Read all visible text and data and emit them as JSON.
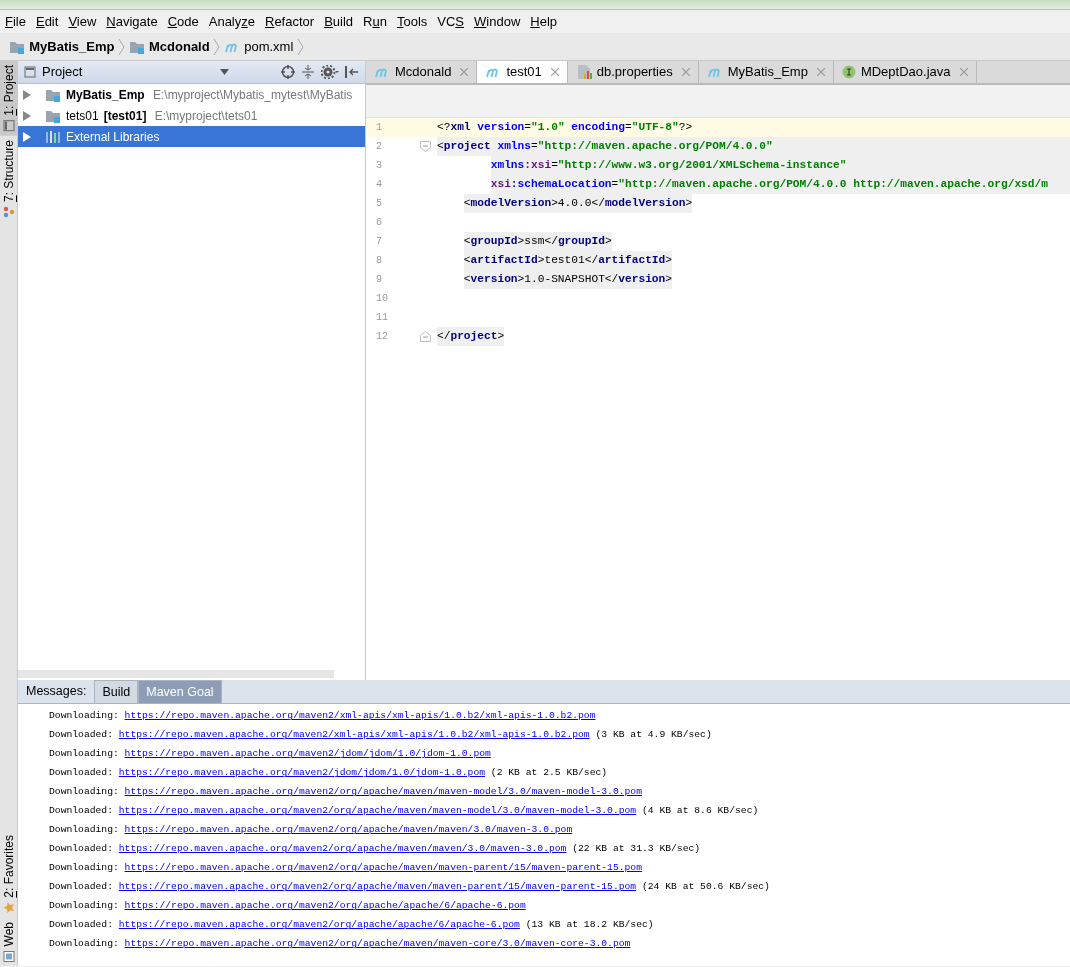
{
  "menu": [
    {
      "key": "F",
      "post": "ile"
    },
    {
      "key": "E",
      "post": "dit"
    },
    {
      "key": "V",
      "post": "iew"
    },
    {
      "key": "N",
      "post": "avigate"
    },
    {
      "key": "C",
      "post": "ode"
    },
    {
      "pre": "Analy",
      "key": "z",
      "post": "e"
    },
    {
      "key": "R",
      "post": "efactor"
    },
    {
      "key": "B",
      "post": "uild"
    },
    {
      "pre": "R",
      "key": "u",
      "post": "n"
    },
    {
      "key": "T",
      "post": "ools"
    },
    {
      "pre": "VC",
      "key": "S"
    },
    {
      "key": "W",
      "post": "indow"
    },
    {
      "key": "H",
      "post": "elp"
    }
  ],
  "breadcrumb": [
    {
      "label": "MyBatis_Emp",
      "kind": "module"
    },
    {
      "label": "Mcdonald",
      "kind": "module"
    },
    {
      "label": "pom.xml",
      "kind": "maven"
    }
  ],
  "side_tabs_top": [
    {
      "key": "1",
      "post": ": Project",
      "selected": true,
      "kind": "project"
    },
    {
      "key": "7",
      "post": ": Structure",
      "selected": false,
      "kind": "structure"
    }
  ],
  "side_tabs_bottom": [
    {
      "key": "2",
      "post": ": Favorites",
      "selected": false,
      "kind": "favorites"
    },
    {
      "post": "Web",
      "selected": false,
      "kind": "web"
    }
  ],
  "project_panel": {
    "title": "Project",
    "items": [
      {
        "name": "MyBatis_Emp",
        "bold": true,
        "path": "E:\\myproject\\Mybatis_mytest\\MyBatis",
        "kind": "module",
        "selected": false,
        "expanded": false
      },
      {
        "name": "tets01",
        "bold": false,
        "module": "[test01]",
        "path": "E:\\myproject\\tets01",
        "kind": "module",
        "selected": false,
        "expanded": false
      },
      {
        "name": "External Libraries",
        "bold": false,
        "kind": "library",
        "selected": true,
        "expanded": false
      }
    ]
  },
  "editor_tabs": [
    {
      "label": "Mcdonald",
      "kind": "maven",
      "selected": false
    },
    {
      "label": "test01",
      "kind": "maven",
      "selected": true
    },
    {
      "label": "db.properties",
      "kind": "properties",
      "selected": false
    },
    {
      "label": "MyBatis_Emp",
      "kind": "maven",
      "selected": false
    },
    {
      "label": "MDeptDao.java",
      "kind": "interface",
      "selected": false
    }
  ],
  "code": [
    {
      "no": "1",
      "kind": "declaration",
      "current": true,
      "matched": false,
      "shaded": false,
      "tokens": [
        {
          "kind": "punct",
          "text": "<?"
        },
        {
          "kind": "tag",
          "text": "xml"
        },
        {
          "kind": "attr",
          "text": " version"
        },
        {
          "kind": "punct",
          "text": "="
        },
        {
          "kind": "value",
          "text": "\"1.0\""
        },
        {
          "kind": "attr",
          "text": " encoding"
        },
        {
          "kind": "punct",
          "text": "="
        },
        {
          "kind": "value",
          "text": "\"UTF-8\""
        },
        {
          "kind": "punct",
          "text": "?>"
        }
      ]
    },
    {
      "no": "2",
      "kind": "open",
      "current": false,
      "matched": true,
      "shaded": false,
      "tokens": [
        {
          "kind": "punct",
          "text": "<"
        },
        {
          "kind": "tag",
          "text": "project"
        },
        {
          "kind": "attr",
          "text": " xmlns"
        },
        {
          "kind": "punct",
          "text": "="
        },
        {
          "kind": "value",
          "text": "\"http://maven.apache.org/POM/4.0.0\""
        }
      ]
    },
    {
      "no": "3",
      "kind": "continuation",
      "current": false,
      "matched": true,
      "shaded": false,
      "tokens": [
        {
          "kind": "attr",
          "text": "xmlns"
        },
        {
          "kind": "ns",
          "text": ":xsi"
        },
        {
          "kind": "punct",
          "text": "="
        },
        {
          "kind": "value",
          "text": "\"http://www.w3.org/2001/XMLSchema-instance\""
        }
      ]
    },
    {
      "no": "4",
      "kind": "continuation",
      "current": false,
      "matched": true,
      "shaded": false,
      "tokens": [
        {
          "kind": "ns",
          "text": "xsi"
        },
        {
          "kind": "attr",
          "text": ":schemaLocation"
        },
        {
          "kind": "punct",
          "text": "="
        },
        {
          "kind": "value",
          "text": "\"http://maven.apache.org/POM/4.0.0 http://maven.apache.org/xsd/m"
        }
      ]
    },
    {
      "no": "5",
      "kind": "child",
      "current": false,
      "matched": false,
      "shaded": true,
      "tokens": [
        {
          "kind": "punct",
          "text": "<"
        },
        {
          "kind": "tag",
          "text": "modelVersion"
        },
        {
          "kind": "punct",
          "text": ">"
        },
        {
          "kind": "plain",
          "text": "4.0.0"
        },
        {
          "kind": "punct",
          "text": "</"
        },
        {
          "kind": "tag",
          "text": "modelVersion"
        },
        {
          "kind": "punct",
          "text": ">"
        }
      ]
    },
    {
      "no": "6",
      "kind": "blank"
    },
    {
      "no": "7",
      "kind": "child",
      "current": false,
      "matched": false,
      "shaded": true,
      "tokens": [
        {
          "kind": "punct",
          "text": "<"
        },
        {
          "kind": "tag",
          "text": "groupId"
        },
        {
          "kind": "punct",
          "text": ">"
        },
        {
          "kind": "plain",
          "text": "ssm"
        },
        {
          "kind": "punct",
          "text": "</"
        },
        {
          "kind": "tag",
          "text": "groupId"
        },
        {
          "kind": "punct",
          "text": ">"
        }
      ]
    },
    {
      "no": "8",
      "kind": "child",
      "current": false,
      "matched": false,
      "shaded": true,
      "tokens": [
        {
          "kind": "punct",
          "text": "<"
        },
        {
          "kind": "tag",
          "text": "artifactId"
        },
        {
          "kind": "punct",
          "text": ">"
        },
        {
          "kind": "plain",
          "text": "test01"
        },
        {
          "kind": "punct",
          "text": "</"
        },
        {
          "kind": "tag",
          "text": "artifactId"
        },
        {
          "kind": "punct",
          "text": ">"
        }
      ]
    },
    {
      "no": "9",
      "kind": "child",
      "current": false,
      "matched": false,
      "shaded": true,
      "tokens": [
        {
          "kind": "punct",
          "text": "<"
        },
        {
          "kind": "tag",
          "text": "version"
        },
        {
          "kind": "punct",
          "text": ">"
        },
        {
          "kind": "plain",
          "text": "1.0-SNAPSHOT"
        },
        {
          "kind": "punct",
          "text": "</"
        },
        {
          "kind": "tag",
          "text": "version"
        },
        {
          "kind": "punct",
          "text": ">"
        }
      ]
    },
    {
      "no": "10",
      "kind": "blank"
    },
    {
      "no": "11",
      "kind": "blank"
    },
    {
      "no": "12",
      "kind": "close",
      "current": false,
      "matched": false,
      "shaded": true,
      "tokens": [
        {
          "kind": "punct",
          "text": "</"
        },
        {
          "kind": "tag",
          "text": "project"
        },
        {
          "kind": "punct",
          "text": ">"
        }
      ]
    }
  ],
  "messages": {
    "label": "Messages:",
    "tabs": [
      {
        "label": "Build",
        "selected": false
      },
      {
        "label": "Maven Goal",
        "selected": true
      }
    ],
    "lines": [
      {
        "prefix": "Downloading:",
        "link": "https://repo.maven.apache.org/maven2/xml-apis/xml-apis/1.0.b2/xml-apis-1.0.b2.pom"
      },
      {
        "prefix": "Downloaded:",
        "link": "https://repo.maven.apache.org/maven2/xml-apis/xml-apis/1.0.b2/xml-apis-1.0.b2.pom",
        "suffix": "(3 KB at 4.9 KB/sec)"
      },
      {
        "prefix": "Downloading:",
        "link": "https://repo.maven.apache.org/maven2/jdom/jdom/1.0/jdom-1.0.pom"
      },
      {
        "prefix": "Downloaded:",
        "link": "https://repo.maven.apache.org/maven2/jdom/jdom/1.0/jdom-1.0.pom",
        "suffix": "(2 KB at 2.5 KB/sec)"
      },
      {
        "prefix": "Downloading:",
        "link": "https://repo.maven.apache.org/maven2/org/apache/maven/maven-model/3.0/maven-model-3.0.pom"
      },
      {
        "prefix": "Downloaded:",
        "link": "https://repo.maven.apache.org/maven2/org/apache/maven/maven-model/3.0/maven-model-3.0.pom",
        "suffix": "(4 KB at 8.6 KB/sec)"
      },
      {
        "prefix": "Downloading:",
        "link": "https://repo.maven.apache.org/maven2/org/apache/maven/maven/3.0/maven-3.0.pom"
      },
      {
        "prefix": "Downloaded:",
        "link": "https://repo.maven.apache.org/maven2/org/apache/maven/maven/3.0/maven-3.0.pom",
        "suffix": "(22 KB at 31.3 KB/sec)"
      },
      {
        "prefix": "Downloading:",
        "link": "https://repo.maven.apache.org/maven2/org/apache/maven/maven-parent/15/maven-parent-15.pom"
      },
      {
        "prefix": "Downloaded:",
        "link": "https://repo.maven.apache.org/maven2/org/apache/maven/maven-parent/15/maven-parent-15.pom",
        "suffix": "(24 KB at 50.6 KB/sec)"
      },
      {
        "prefix": "Downloading:",
        "link": "https://repo.maven.apache.org/maven2/org/apache/apache/6/apache-6.pom"
      },
      {
        "prefix": "Downloaded:",
        "link": "https://repo.maven.apache.org/maven2/org/apache/apache/6/apache-6.pom",
        "suffix": "(13 KB at 18.2 KB/sec)"
      },
      {
        "prefix": "Downloading:",
        "link": "https://repo.maven.apache.org/maven2/org/apache/maven/maven-core/3.0/maven-core-3.0.pom"
      }
    ]
  }
}
